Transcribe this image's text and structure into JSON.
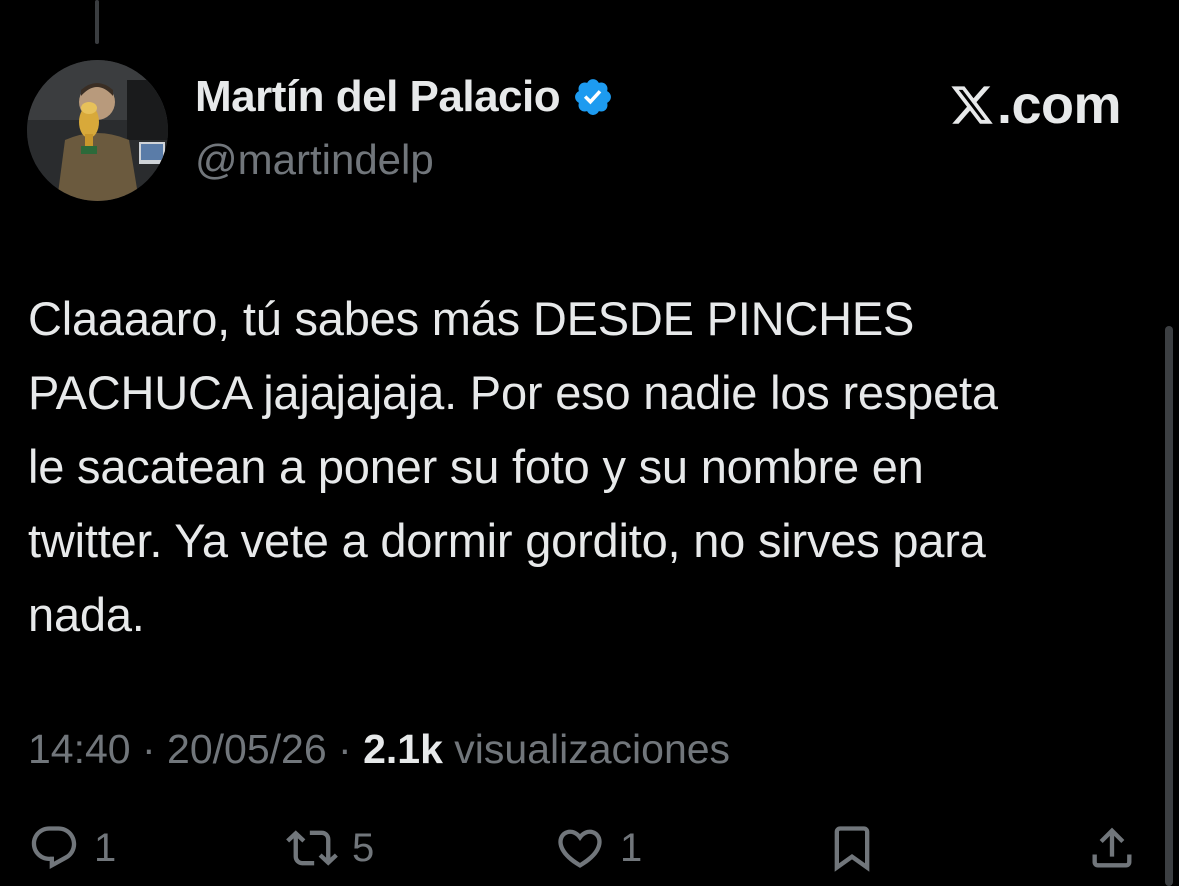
{
  "author": {
    "display_name": "Martín del Palacio",
    "handle": "@martindelp",
    "verified": true,
    "verified_color": "#1d9bf0"
  },
  "brand": {
    "logo_icon": "x-logo-icon",
    "logo_text": ".com"
  },
  "tweet": {
    "text": "Claaaaro, tú sabes más DESDE PINCHES\nPACHUCA jajajajaja. Por eso nadie los respeta\nle sacatean a poner su foto y su nombre en\ntwitter. Ya vete a dormir gordito, no sirves para\nnada."
  },
  "meta": {
    "time": "14:40",
    "separator": " · ",
    "date": "20/05/26",
    "views_count": "2.1k",
    "views_label": " visualizaciones"
  },
  "actions": {
    "reply": {
      "icon": "reply-icon",
      "count": "1"
    },
    "retweet": {
      "icon": "retweet-icon",
      "count": "5"
    },
    "like": {
      "icon": "heart-icon",
      "count": "1"
    },
    "bookmark": {
      "icon": "bookmark-icon"
    },
    "share": {
      "icon": "share-icon"
    }
  },
  "colors": {
    "background": "#000000",
    "text_primary": "#e7e9ea",
    "text_secondary": "#71767b"
  }
}
